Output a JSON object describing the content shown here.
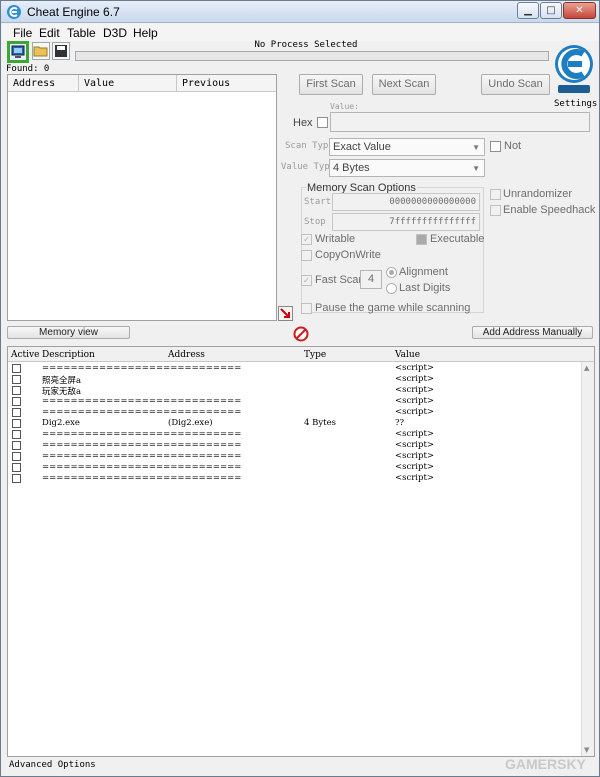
{
  "window": {
    "title": "Cheat Engine 6.7"
  },
  "menu": [
    "File",
    "Edit",
    "Table",
    "D3D",
    "Help"
  ],
  "toolbar": {
    "process": "No Process Selected",
    "found": "Found: 0",
    "settings": "Settings"
  },
  "result_list": {
    "columns": [
      "Address",
      "Value",
      "Previous"
    ]
  },
  "scan": {
    "first_scan": "First Scan",
    "next_scan": "Next Scan",
    "undo_scan": "Undo Scan",
    "value_label": "Value:",
    "hex_label": "Hex",
    "scan_type_label": "Scan Type",
    "scan_type_value": "Exact Value",
    "not_label": "Not",
    "value_type_label": "Value Type",
    "value_type_value": "4 Bytes"
  },
  "memory_scan_options": {
    "title": "Memory Scan Options",
    "start_label": "Start",
    "start_value": "0000000000000000",
    "stop_label": "Stop",
    "stop_value": "7fffffffffffffff",
    "writable": "Writable",
    "executable": "Executable",
    "copy_on_write": "CopyOnWrite",
    "fast_scan": "Fast Scan",
    "fast_scan_value": "4",
    "alignment": "Alignment",
    "last_digits": "Last Digits",
    "pause": "Pause the game while scanning"
  },
  "extra_options": {
    "unrandomizer": "Unrandomizer",
    "speedhack": "Enable Speedhack"
  },
  "buttons": {
    "memory_view": "Memory view",
    "add_manually": "Add Address Manually"
  },
  "address_list": {
    "columns": [
      "Active",
      "Description",
      "Address",
      "Type",
      "Value"
    ],
    "rows": [
      {
        "description": "============================",
        "address": "",
        "type": "",
        "value": "<script>"
      },
      {
        "description": "照亮全屏a",
        "address": "",
        "type": "",
        "value": "<script>"
      },
      {
        "description": "玩家无敌a",
        "address": "",
        "type": "",
        "value": "<script>"
      },
      {
        "description": "============================",
        "address": "",
        "type": "",
        "value": "<script>"
      },
      {
        "description": "============================",
        "address": "",
        "type": "",
        "value": "<script>"
      },
      {
        "description": "Dig2.exe",
        "address": "(Dig2.exe)",
        "type": "4 Bytes",
        "value": "??"
      },
      {
        "description": "============================",
        "address": "",
        "type": "",
        "value": "<script>"
      },
      {
        "description": "============================",
        "address": "",
        "type": "",
        "value": "<script>"
      },
      {
        "description": "============================",
        "address": "",
        "type": "",
        "value": "<script>"
      },
      {
        "description": "============================",
        "address": "",
        "type": "",
        "value": "<script>"
      },
      {
        "description": "============================",
        "address": "",
        "type": "",
        "value": "<script>"
      }
    ]
  },
  "footer": {
    "advanced": "Advanced Options",
    "watermark": "GAMERSKY"
  }
}
